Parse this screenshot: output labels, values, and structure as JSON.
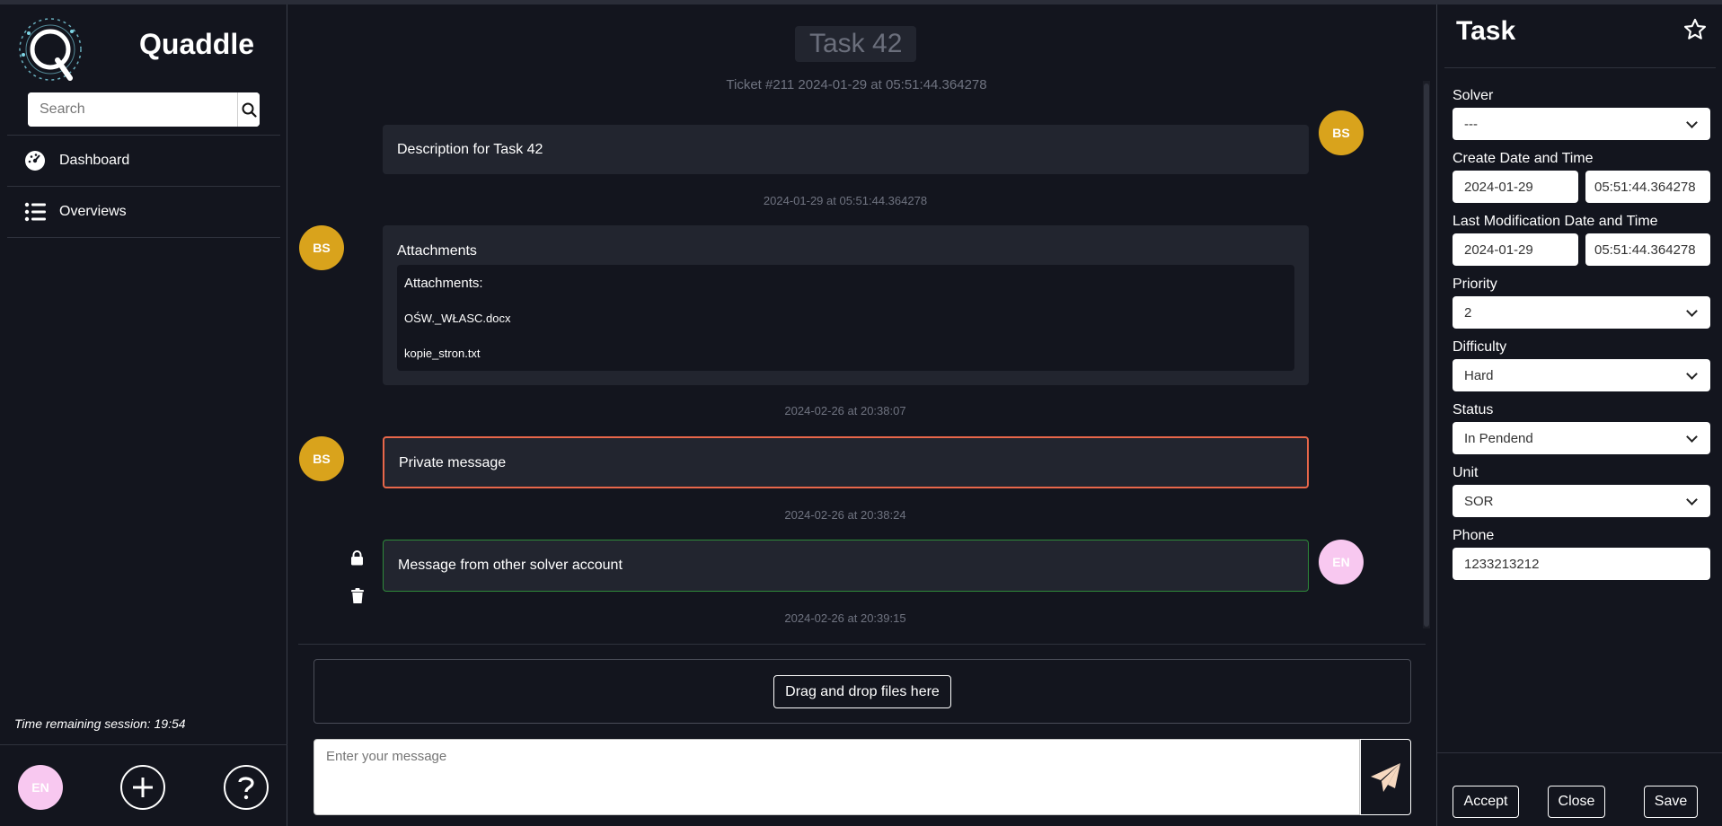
{
  "sidebar": {
    "brand": "Quaddle",
    "search_placeholder": "Search",
    "nav": [
      {
        "label": "Dashboard",
        "icon": "gauge-icon"
      },
      {
        "label": "Overviews",
        "icon": "list-icon"
      }
    ],
    "session_text": "Time remaining session: 19:54",
    "user_initials": "EN"
  },
  "chat": {
    "title": "Task 42",
    "ticket_info": "Ticket #211 2024-01-29 at 05:51:44.364278",
    "messages": [
      {
        "author": "BS",
        "text": "Description for Task 42",
        "timestamp": "2024-01-29 at 05:51:44.364278"
      },
      {
        "author": "BS",
        "title": "Attachments",
        "attachments_label": "Attachments:",
        "files": [
          "OŚW._WŁASC.docx",
          "kopie_stron.txt"
        ],
        "timestamp": "2024-02-26 at 20:38:07"
      },
      {
        "author": "BS",
        "text": "Private message",
        "timestamp": "2024-02-26 at 20:38:24"
      },
      {
        "author": "EN",
        "text": "Message from other solver account",
        "timestamp": "2024-02-26 at 20:39:15"
      }
    ],
    "dropzone_label": "Drag and drop files here",
    "input_placeholder": "Enter your message"
  },
  "panel": {
    "title": "Task",
    "fields": {
      "solver": {
        "label": "Solver",
        "value": "---"
      },
      "create": {
        "label": "Create Date and Time",
        "date": "2024-01-29",
        "time": "05:51:44.364278"
      },
      "modified": {
        "label": "Last Modification Date and Time",
        "date": "2024-01-29",
        "time": "05:51:44.364278"
      },
      "priority": {
        "label": "Priority",
        "value": "2"
      },
      "difficulty": {
        "label": "Difficulty",
        "value": "Hard"
      },
      "status": {
        "label": "Status",
        "value": "In Pendend"
      },
      "unit": {
        "label": "Unit",
        "value": "SOR"
      },
      "phone": {
        "label": "Phone",
        "value": "1233213212"
      }
    },
    "buttons": {
      "accept": "Accept",
      "close": "Close",
      "save": "Save"
    }
  },
  "colors": {
    "background": "#13151e",
    "bubble": "#22252f",
    "avatar_bs": "#d9a31c",
    "avatar_en": "#f8c8f0",
    "private_border": "#e8674a",
    "other_solver_border": "#2e8a3a"
  }
}
